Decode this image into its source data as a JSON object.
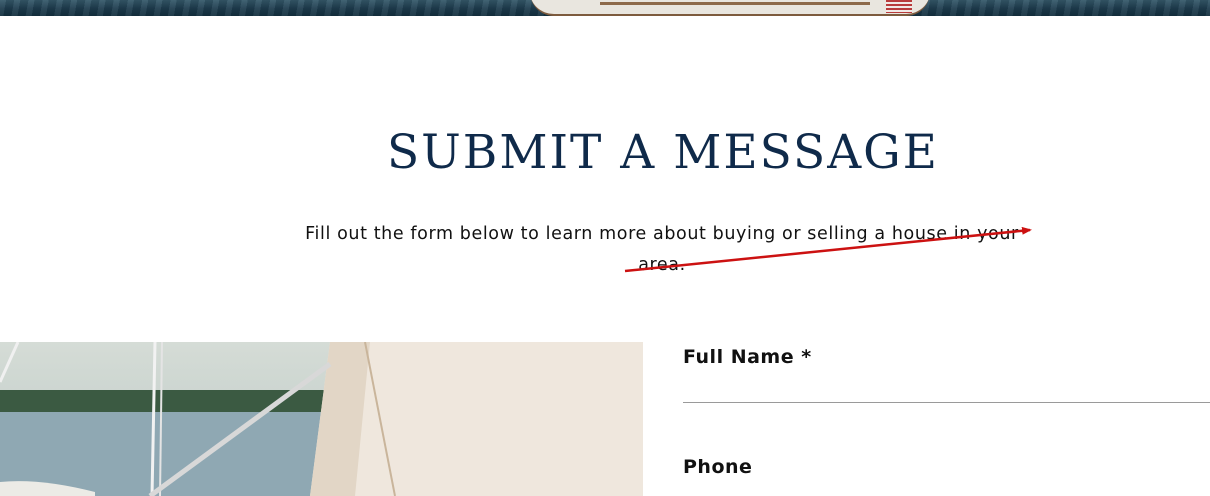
{
  "hero": {
    "image_alt": "sailboat on water"
  },
  "section": {
    "title": "SUBMIT A MESSAGE",
    "subtitle": "Fill out the form below to learn more about buying or selling a house in your area."
  },
  "photo": {
    "image_alt": "sailboat sails and lake"
  },
  "form": {
    "fields": [
      {
        "label": "Full Name *",
        "value": ""
      },
      {
        "label": "Phone",
        "value": ""
      }
    ]
  },
  "colors": {
    "title": "#0f2a4a",
    "body_text": "#111111",
    "annotation_arrow": "#cc1111",
    "input_underline": "#9a9a9a"
  }
}
